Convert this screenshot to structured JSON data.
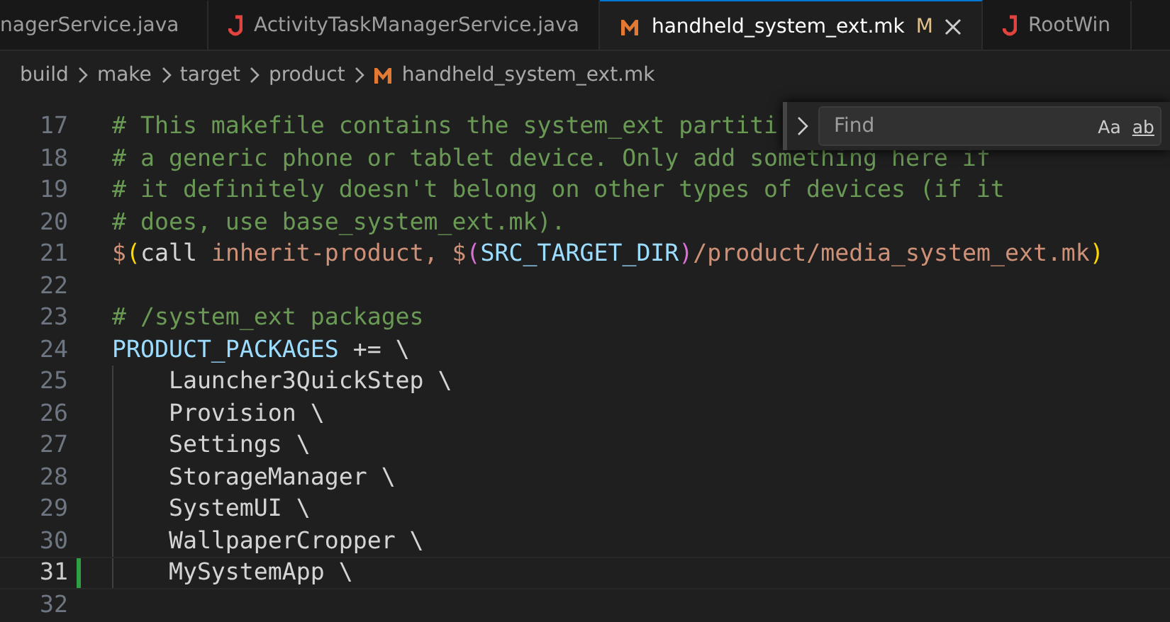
{
  "tabs": [
    {
      "label": "nagerService.java",
      "kind": "none",
      "selected": false,
      "modified": false
    },
    {
      "label": "ActivityTaskManagerService.java",
      "kind": "java",
      "selected": false,
      "modified": false
    },
    {
      "label": "handheld_system_ext.mk",
      "kind": "makefile",
      "selected": true,
      "modified": true,
      "modified_mark": "M"
    },
    {
      "label": "RootWin",
      "kind": "java",
      "selected": false,
      "modified": false
    }
  ],
  "breadcrumbs": [
    {
      "label": "build",
      "kind": "folder"
    },
    {
      "label": "make",
      "kind": "folder"
    },
    {
      "label": "target",
      "kind": "folder"
    },
    {
      "label": "product",
      "kind": "folder"
    },
    {
      "label": "handheld_system_ext.mk",
      "kind": "makefile"
    }
  ],
  "editor": {
    "lines": [
      {
        "number": "17",
        "current": false,
        "modified": false,
        "tokens": [
          {
            "text": "# This makefile contains the system_ext partiti",
            "kind": "comment"
          }
        ]
      },
      {
        "number": "18",
        "current": false,
        "modified": false,
        "tokens": [
          {
            "text": "# a generic phone or tablet device. Only add something here if",
            "kind": "comment"
          }
        ]
      },
      {
        "number": "19",
        "current": false,
        "modified": false,
        "tokens": [
          {
            "text": "# it definitely doesn't belong on other types of devices (if it",
            "kind": "comment"
          }
        ]
      },
      {
        "number": "20",
        "current": false,
        "modified": false,
        "tokens": [
          {
            "text": "# does, use base_system_ext.mk).",
            "kind": "comment"
          }
        ]
      },
      {
        "number": "21",
        "current": false,
        "modified": false,
        "tokens": [
          {
            "text": "$",
            "kind": "string"
          },
          {
            "text": "(",
            "kind": "bracket1"
          },
          {
            "text": "call",
            "kind": "plain"
          },
          {
            "text": " inherit-product, ",
            "kind": "string"
          },
          {
            "text": "$",
            "kind": "string"
          },
          {
            "text": "(",
            "kind": "bracket2"
          },
          {
            "text": "SRC_TARGET_DIR",
            "kind": "variable"
          },
          {
            "text": ")",
            "kind": "bracket2"
          },
          {
            "text": "/product/media_system_ext.mk",
            "kind": "string"
          },
          {
            "text": ")",
            "kind": "bracket1"
          }
        ]
      },
      {
        "number": "22",
        "current": false,
        "modified": false
      },
      {
        "number": "23",
        "current": false,
        "modified": false,
        "tokens": [
          {
            "text": "# /system_ext packages",
            "kind": "comment"
          }
        ]
      },
      {
        "number": "24",
        "current": false,
        "modified": false,
        "tokens": [
          {
            "text": "PRODUCT_PACKAGES",
            "kind": "variable"
          },
          {
            "text": " += \\",
            "kind": "plain"
          }
        ]
      },
      {
        "number": "25",
        "current": false,
        "modified": false,
        "indent": true,
        "tokens": [
          {
            "text": "    Launcher3QuickStep \\",
            "kind": "plain"
          }
        ]
      },
      {
        "number": "26",
        "current": false,
        "modified": false,
        "indent": true,
        "tokens": [
          {
            "text": "    Provision \\",
            "kind": "plain"
          }
        ]
      },
      {
        "number": "27",
        "current": false,
        "modified": false,
        "indent": true,
        "tokens": [
          {
            "text": "    Settings \\",
            "kind": "plain"
          }
        ]
      },
      {
        "number": "28",
        "current": false,
        "modified": false,
        "indent": true,
        "tokens": [
          {
            "text": "    StorageManager \\",
            "kind": "plain"
          }
        ]
      },
      {
        "number": "29",
        "current": false,
        "modified": false,
        "indent": true,
        "tokens": [
          {
            "text": "    SystemUI \\",
            "kind": "plain"
          }
        ]
      },
      {
        "number": "30",
        "current": false,
        "modified": false,
        "indent": true,
        "tokens": [
          {
            "text": "    WallpaperCropper \\",
            "kind": "plain"
          }
        ]
      },
      {
        "number": "31",
        "current": true,
        "modified": true,
        "indent": true,
        "tokens": [
          {
            "text": "    MySystemApp \\",
            "kind": "plain"
          }
        ]
      },
      {
        "number": "32",
        "current": false,
        "modified": false
      }
    ]
  },
  "find_widget": {
    "placeholder": "Find",
    "expanded": false,
    "options": [
      "Aa",
      "ab"
    ]
  }
}
